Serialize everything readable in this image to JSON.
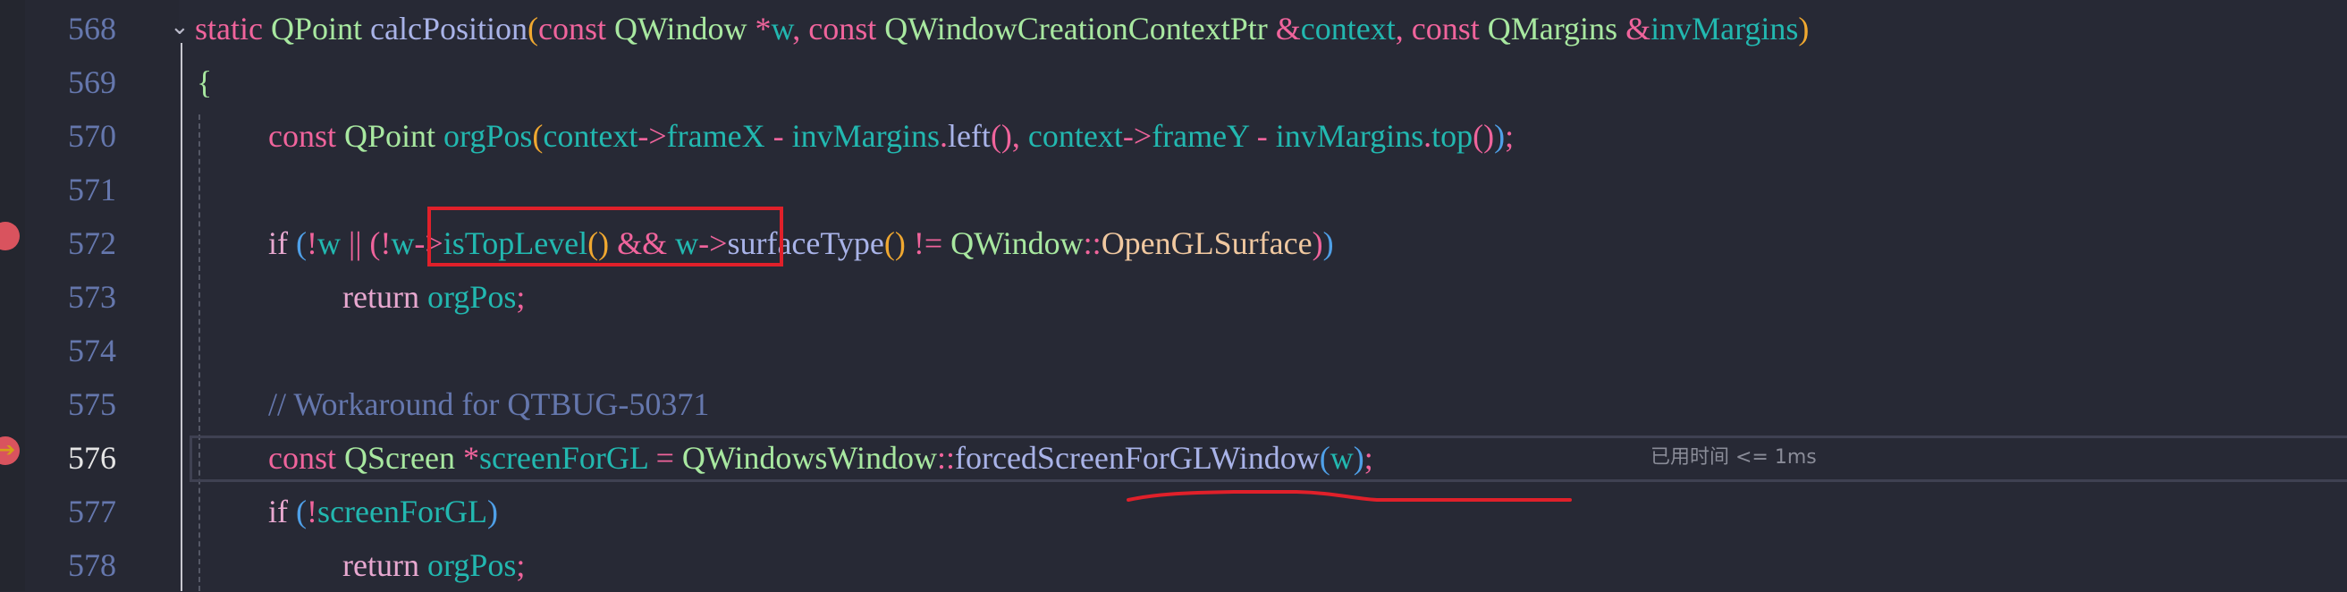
{
  "editor": {
    "language": "C++",
    "current_line": 576,
    "breakpoint_line": 572,
    "inline_hint": "已用时间 <= 1ms",
    "colors": {
      "background": "#272935",
      "keyword": "#f0649c",
      "type": "#a8e8a0",
      "function": "#a9b3e8",
      "variable": "#22b8b0",
      "comment": "#6577ad",
      "line_number": "#6577ad",
      "annotation_red": "#e0202a",
      "breakpoint": "#d9535e"
    },
    "lines": [
      {
        "number": "568"
      },
      {
        "number": "569"
      },
      {
        "number": "570"
      },
      {
        "number": "571"
      },
      {
        "number": "572"
      },
      {
        "number": "573"
      },
      {
        "number": "574"
      },
      {
        "number": "575"
      },
      {
        "number": "576"
      },
      {
        "number": "577"
      },
      {
        "number": "578"
      }
    ],
    "tokens": {
      "l568": [
        "static",
        "QPoint",
        "calcPosition",
        "(",
        "const",
        "QWindow",
        "*",
        "w",
        ",",
        "const",
        "QWindowCreationContextPtr",
        "&",
        "context",
        ",",
        "const",
        "QMargins",
        "&",
        "invMargins",
        ")"
      ],
      "l569": [
        "{"
      ],
      "l570": [
        "const",
        "QPoint",
        "orgPos",
        "(",
        "context",
        "->",
        "frameX",
        "-",
        "invMargins",
        ".",
        "left",
        "()",
        ",",
        "context",
        "->",
        "frameY",
        "-",
        "invMargins",
        ".",
        "top",
        "(",
        ")",
        ")",
        ";"
      ],
      "l572": [
        "if",
        "(",
        "!",
        "w",
        "||",
        "(",
        "!",
        "w",
        "->",
        "isTopLevel",
        "()",
        "&&",
        "w",
        "->",
        "surfaceType",
        "()",
        "!=",
        "QWindow",
        "::",
        "OpenGLSurface",
        ")",
        ")"
      ],
      "l573": [
        "return",
        "orgPos",
        ";"
      ],
      "l575": [
        "// Workaround for QTBUG-50371"
      ],
      "l576": [
        "const",
        "QScreen",
        "*",
        "screenForGL",
        "=",
        "QWindowsWindow",
        "::",
        "forcedScreenForGLWindow",
        "(",
        "w",
        ")",
        ";"
      ],
      "l577": [
        "if",
        "(",
        "!",
        "screenForGL",
        ")"
      ],
      "l578": [
        "return",
        "orgPos",
        ";"
      ]
    }
  }
}
